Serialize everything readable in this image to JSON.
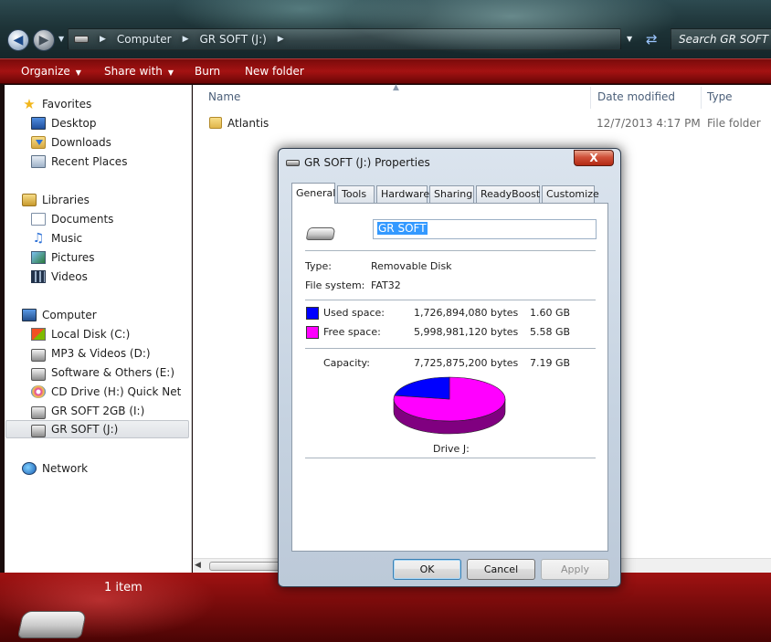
{
  "address": {
    "crumbs": [
      "Computer",
      "GR SOFT (J:)"
    ],
    "search_placeholder": "Search GR SOFT (J:)"
  },
  "toolbar": {
    "organize": "Organize",
    "share_with": "Share with",
    "burn": "Burn",
    "new_folder": "New folder"
  },
  "nav": {
    "favorites": {
      "label": "Favorites",
      "items": [
        "Desktop",
        "Downloads",
        "Recent Places"
      ]
    },
    "libraries": {
      "label": "Libraries",
      "items": [
        "Documents",
        "Music",
        "Pictures",
        "Videos"
      ]
    },
    "computer": {
      "label": "Computer",
      "items": [
        "Local Disk (C:)",
        "MP3 & Videos (D:)",
        "Software & Others (E:)",
        "CD Drive (H:) Quick Net",
        "GR SOFT 2GB (I:)",
        "GR SOFT (J:)"
      ]
    },
    "network": {
      "label": "Network"
    }
  },
  "filelist": {
    "columns": {
      "name": "Name",
      "date": "Date modified",
      "type": "Type"
    },
    "rows": [
      {
        "name": "Atlantis",
        "date": "12/7/2013 4:17 PM",
        "type": "File folder"
      }
    ]
  },
  "status": {
    "count": "1 item"
  },
  "dialog": {
    "title": "GR SOFT (J:) Properties",
    "close_label": "X",
    "tabs": [
      "General",
      "Tools",
      "Hardware",
      "Sharing",
      "ReadyBoost",
      "Customize"
    ],
    "drive_name": "GR SOFT",
    "type_label": "Type:",
    "type_value": "Removable Disk",
    "fs_label": "File system:",
    "fs_value": "FAT32",
    "used_label": "Used space:",
    "used_bytes": "1,726,894,080 bytes",
    "used_gb": "1.60 GB",
    "free_label": "Free space:",
    "free_bytes": "5,998,981,120 bytes",
    "free_gb": "5.58 GB",
    "capacity_label": "Capacity:",
    "capacity_bytes": "7,725,875,200 bytes",
    "capacity_gb": "7.19 GB",
    "pie_caption": "Drive J:",
    "used_fraction": 0.2235,
    "used_color": "#0000ff",
    "free_color": "#ff00ff",
    "ok": "OK",
    "cancel": "Cancel",
    "apply": "Apply"
  }
}
